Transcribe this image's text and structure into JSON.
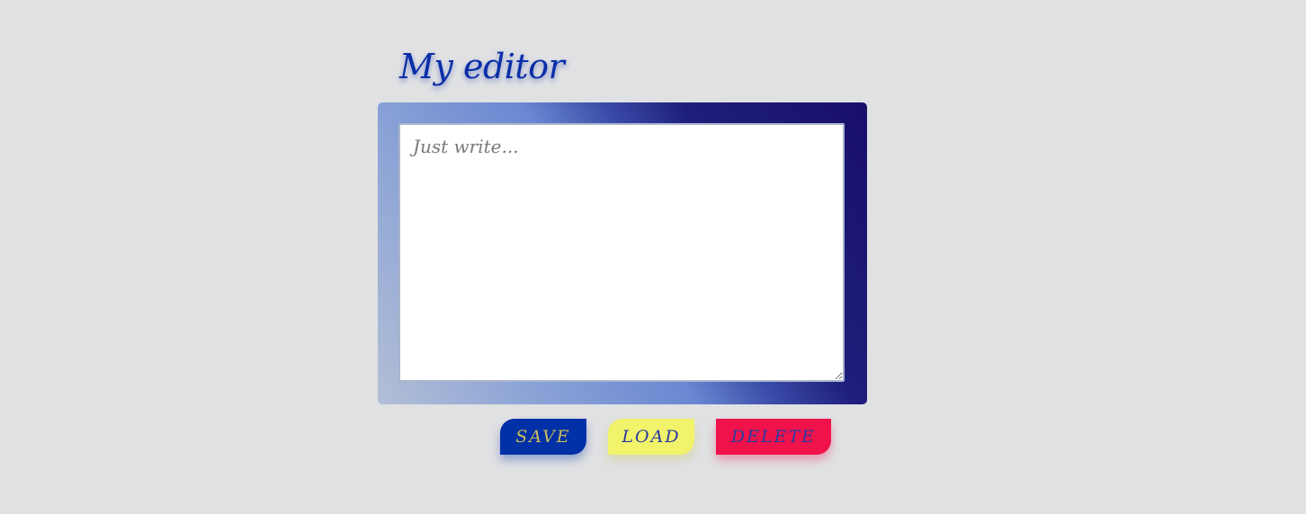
{
  "header": {
    "title": "My editor"
  },
  "editor": {
    "value": "",
    "placeholder": "Just write..."
  },
  "actions": {
    "save_label": "SAVE",
    "load_label": "LOAD",
    "delete_label": "DELETE"
  },
  "colors": {
    "background": "#e0e1e3",
    "title": "#0a2ea8",
    "save_button": "#0230a6",
    "load_button": "#f1f36a",
    "delete_button": "#f0124a",
    "frame_gradient_dark": "#180f6a",
    "frame_gradient_light": "#b3bfd6"
  }
}
